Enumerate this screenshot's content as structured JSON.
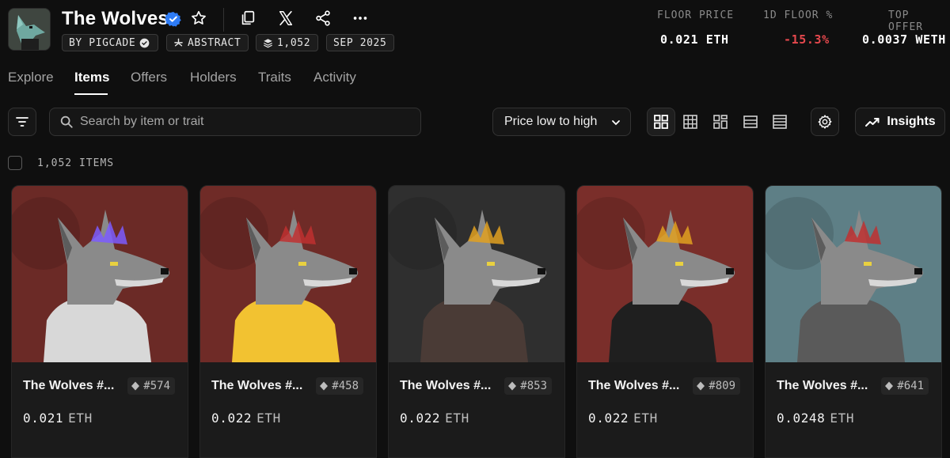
{
  "collection": {
    "title": "The Wolves",
    "creator": "BY PIGCADE",
    "chain": "ABSTRACT",
    "supply": "1,052",
    "date": "SEP 2025"
  },
  "stats": [
    {
      "label": "FLOOR PRICE",
      "value": "0.021 ETH",
      "color": "#ffffff"
    },
    {
      "label": "1D FLOOR %",
      "value": "-15.3%",
      "color": "#e5484d"
    },
    {
      "label": "TOP OFFER",
      "value": "0.0037 WETH",
      "color": "#ffffff"
    }
  ],
  "tabs": [
    "Explore",
    "Items",
    "Offers",
    "Holders",
    "Traits",
    "Activity"
  ],
  "active_tab": "Items",
  "toolbar": {
    "search_placeholder": "Search by item or trait",
    "sort_label": "Price low to high",
    "insights_label": "Insights"
  },
  "items_count": "1,052 ITEMS",
  "items": [
    {
      "name": "The Wolves #...",
      "token": "#574",
      "price": "0.021",
      "unit": "ETH",
      "bg": "#6b2a26",
      "accent": "#7b5cff",
      "clothing": "#d8d8d8"
    },
    {
      "name": "The Wolves #...",
      "token": "#458",
      "price": "0.022",
      "unit": "ETH",
      "bg": "#6f2b27",
      "accent": "#c03030",
      "clothing": "#f2c231"
    },
    {
      "name": "The Wolves #...",
      "token": "#853",
      "price": "0.022",
      "unit": "ETH",
      "bg": "#2f2f2f",
      "accent": "#e0a020",
      "clothing": "#4a3b36"
    },
    {
      "name": "The Wolves #...",
      "token": "#809",
      "price": "0.022",
      "unit": "ETH",
      "bg": "#7a2e2a",
      "accent": "#e0a020",
      "clothing": "#1f1f1f"
    },
    {
      "name": "The Wolves #...",
      "token": "#641",
      "price": "0.0248",
      "unit": "ETH",
      "bg": "#5e7f86",
      "accent": "#c03030",
      "clothing": "#5a5a5a"
    }
  ]
}
